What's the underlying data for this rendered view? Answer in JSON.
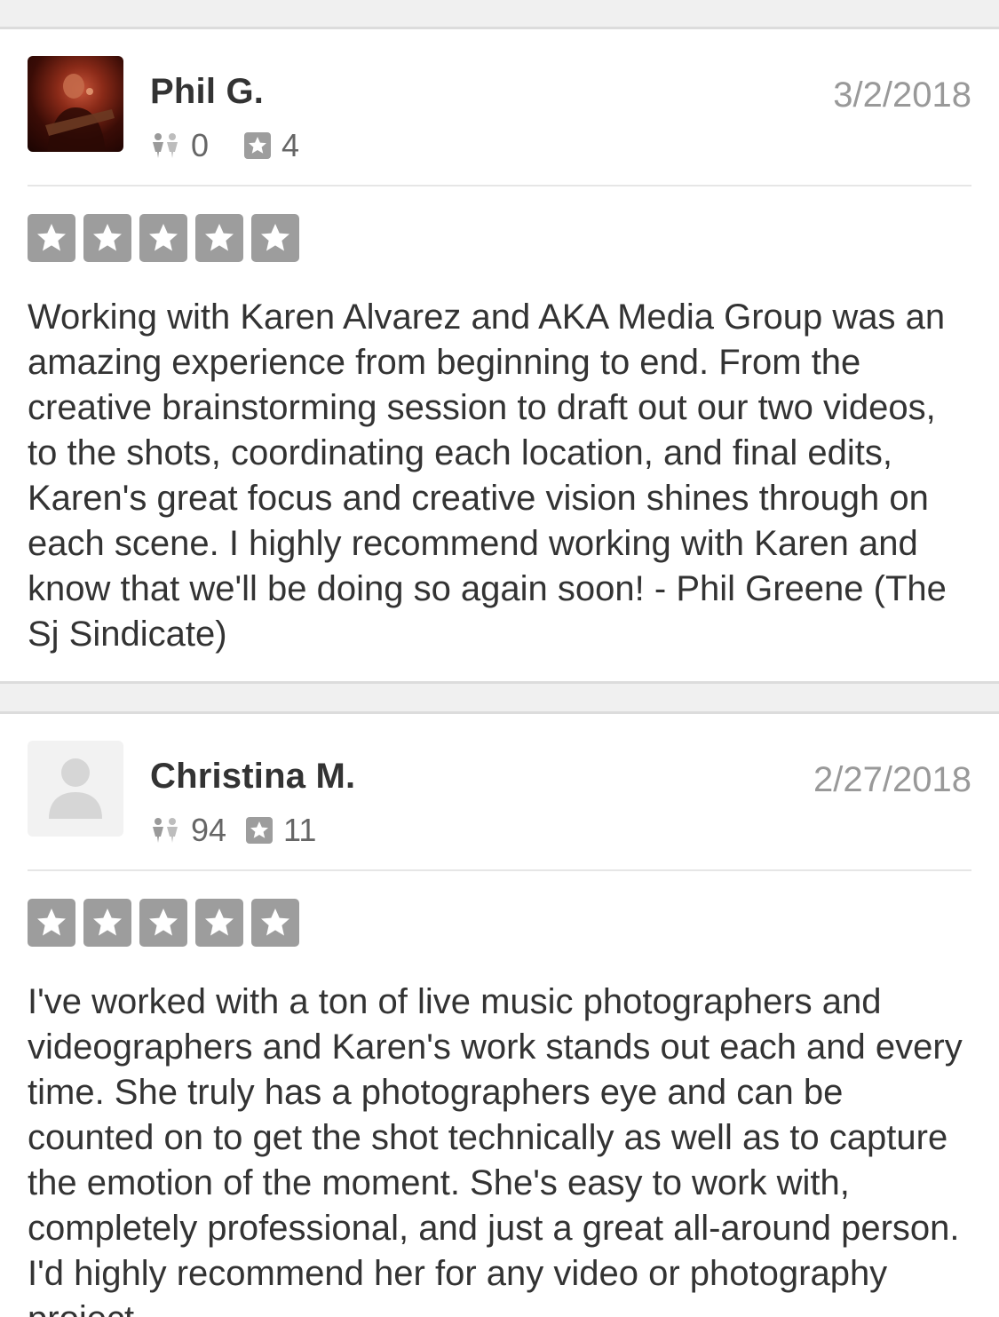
{
  "reviews": [
    {
      "user_name": "Phil G.",
      "date": "3/2/2018",
      "friends_count": "0",
      "reviews_count": "4",
      "avatar_icon": "user-photo",
      "rating": 5,
      "text": "Working with Karen Alvarez and AKA Media Group was an amazing experience from beginning to end. From the creative brainstorming session to draft out our two videos, to the shots, coordinating each location, and final edits, Karen's great focus and creative vision shines through on each scene. I highly recommend working with Karen and know that we'll be doing so again soon! - Phil Greene (The Sj Sindicate)"
    },
    {
      "user_name": "Christina M.",
      "date": "2/27/2018",
      "friends_count": "94",
      "reviews_count": "11",
      "avatar_icon": "default-avatar-icon",
      "rating": 5,
      "text": "I've worked with a ton of live music photographers and videographers and Karen's work stands out each and every time. She truly has a photographers eye and can be counted on to get the shot technically as well as to capture the emotion of the moment. She's easy to work with, completely professional, and just a great all-around person. I'd highly recommend her for any video or photography project."
    }
  ],
  "colors": {
    "star_box": "#9d9d9d",
    "text": "#333333",
    "muted": "#999999",
    "stats": "#666666"
  }
}
